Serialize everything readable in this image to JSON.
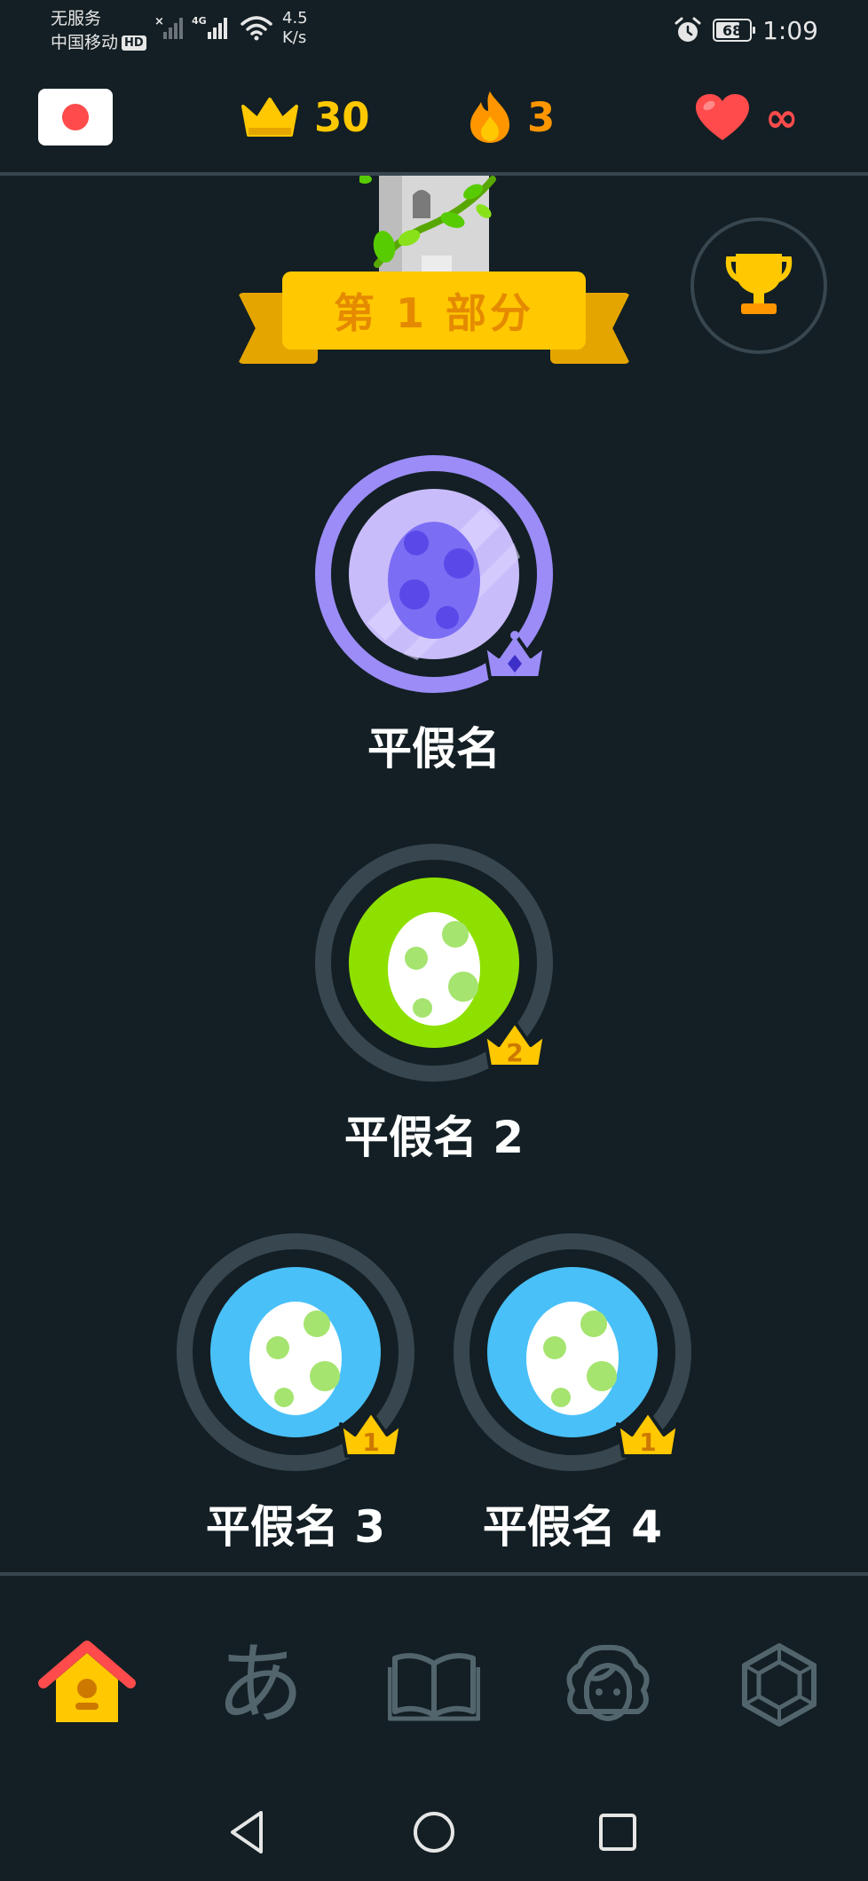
{
  "status_bar": {
    "carrier_line1": "无服务",
    "carrier_line2": "中国移动",
    "hd_badge": "HD",
    "network": "4G",
    "speed_value": "4.5",
    "speed_unit": "K/s",
    "battery": "68",
    "time": "1:09"
  },
  "topbar": {
    "language_flag": "japan-flag-icon",
    "crowns": "30",
    "streak": "3",
    "hearts": "∞"
  },
  "section": {
    "title": "第 1 部分"
  },
  "skills": [
    {
      "label": "平假名",
      "state": "legendary",
      "color": "#9b8cf7"
    },
    {
      "label": "平假名 2",
      "level": "2",
      "color": "#8ee000"
    },
    {
      "label": "平假名 3",
      "level": "1",
      "color": "#49c0f8"
    },
    {
      "label": "平假名 4",
      "level": "1",
      "color": "#49c0f8"
    }
  ],
  "bottom_nav": {
    "items": [
      "home-icon",
      "characters-icon",
      "stories-icon",
      "profile-icon",
      "shop-icon"
    ],
    "characters_glyph": "あ",
    "active": "home-icon"
  },
  "colors": {
    "background": "#131f24",
    "divider": "#37464f",
    "gold": "#ffc800",
    "orange": "#ff9600",
    "red": "#ff4b4b",
    "inactive_icon": "#52656d"
  }
}
